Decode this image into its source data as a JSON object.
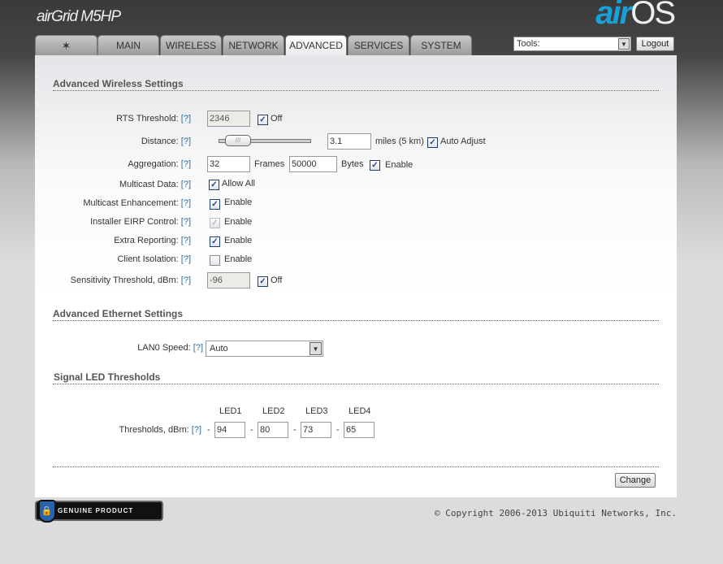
{
  "header": {
    "product_logo": "airGrid M5HP",
    "os_logo": "airOS"
  },
  "tabs": [
    {
      "label": "",
      "icon": "ubiquiti-logo-icon"
    },
    {
      "label": "MAIN"
    },
    {
      "label": "WIRELESS"
    },
    {
      "label": "NETWORK"
    },
    {
      "label": "ADVANCED",
      "active": true
    },
    {
      "label": "SERVICES"
    },
    {
      "label": "SYSTEM"
    }
  ],
  "tools": {
    "value": "Tools:",
    "logout": "Logout"
  },
  "help": "[?]",
  "wireless": {
    "title": "Advanced Wireless Settings",
    "rts": {
      "label": "RTS Threshold:",
      "value": "2346",
      "off_label": "Off",
      "off": true
    },
    "distance": {
      "label": "Distance:",
      "value": "3.1",
      "unit": "miles (5 km)",
      "auto_label": "Auto Adjust",
      "auto": true,
      "slider_fraction": 0.05
    },
    "aggregation": {
      "label": "Aggregation:",
      "frames": "32",
      "frames_label": "Frames",
      "bytes": "50000",
      "bytes_label": "Bytes",
      "enable_label": "Enable",
      "enable": true
    },
    "multicast_data": {
      "label": "Multicast Data:",
      "opt": "Allow All",
      "checked": true
    },
    "multicast_enh": {
      "label": "Multicast Enhancement:",
      "opt": "Enable",
      "checked": true
    },
    "eirp": {
      "label": "Installer EIRP Control:",
      "opt": "Enable",
      "checked": true,
      "disabled": true
    },
    "extra": {
      "label": "Extra Reporting:",
      "opt": "Enable",
      "checked": true
    },
    "isolation": {
      "label": "Client Isolation:",
      "opt": "Enable",
      "checked": false
    },
    "sensitivity": {
      "label": "Sensitivity Threshold, dBm:",
      "value": "-96",
      "off_label": "Off",
      "off": true
    }
  },
  "ethernet": {
    "title": "Advanced Ethernet Settings",
    "lan0": {
      "label": "LAN0 Speed:",
      "value": "Auto"
    }
  },
  "led": {
    "title": "Signal LED Thresholds",
    "label": "Thresholds, dBm:",
    "dash": "-",
    "heads": [
      "LED1",
      "LED2",
      "LED3",
      "LED4"
    ],
    "values": [
      "94",
      "80",
      "73",
      "65"
    ]
  },
  "change": "Change",
  "footer": {
    "badge": "GENUINE PRODUCT",
    "copyright": "© Copyright 2006-2013 Ubiquiti Networks, Inc."
  }
}
